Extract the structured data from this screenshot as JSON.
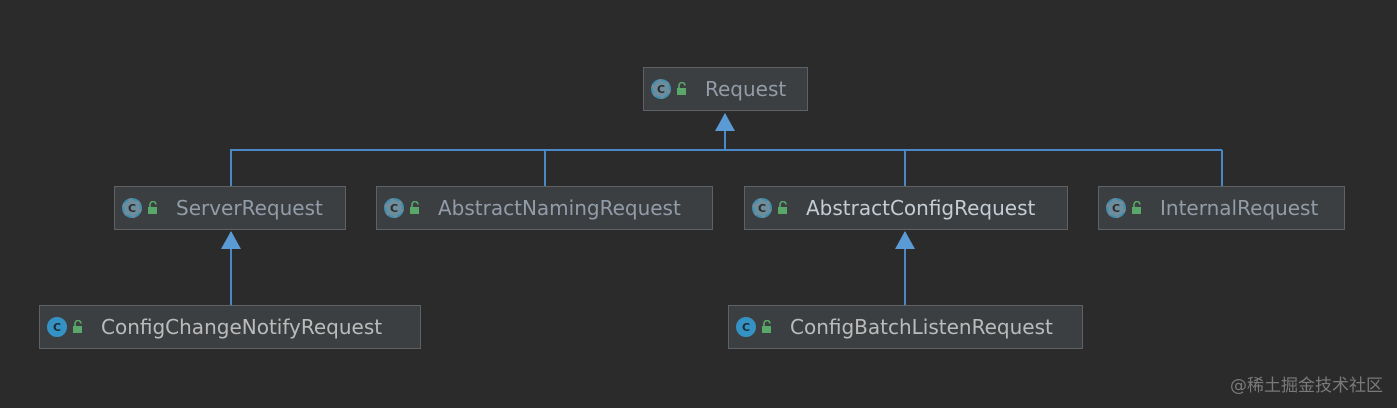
{
  "diagram": {
    "nodes": {
      "request": {
        "label": "Request",
        "kind": "abstract"
      },
      "server_request": {
        "label": "ServerRequest",
        "kind": "abstract"
      },
      "abstract_naming_request": {
        "label": "AbstractNamingRequest",
        "kind": "abstract"
      },
      "abstract_config_request": {
        "label": "AbstractConfigRequest",
        "kind": "abstract"
      },
      "internal_request": {
        "label": "InternalRequest",
        "kind": "abstract"
      },
      "config_change_notify_request": {
        "label": "ConfigChangeNotifyRequest",
        "kind": "class"
      },
      "config_batch_listen_request": {
        "label": "ConfigBatchListenRequest",
        "kind": "class"
      }
    },
    "edges": [
      {
        "from": "server_request",
        "to": "request",
        "type": "extends"
      },
      {
        "from": "abstract_naming_request",
        "to": "request",
        "type": "extends"
      },
      {
        "from": "abstract_config_request",
        "to": "request",
        "type": "extends"
      },
      {
        "from": "internal_request",
        "to": "request",
        "type": "extends"
      },
      {
        "from": "config_change_notify_request",
        "to": "server_request",
        "type": "extends"
      },
      {
        "from": "config_batch_listen_request",
        "to": "abstract_config_request",
        "type": "extends"
      }
    ],
    "icon_letter": "C",
    "colors": {
      "background": "#2b2b2b",
      "edge": "#4a88c7",
      "class_icon": "#3592c4",
      "lock_icon": "#59a869"
    }
  },
  "watermark": "@稀土掘金技术社区"
}
